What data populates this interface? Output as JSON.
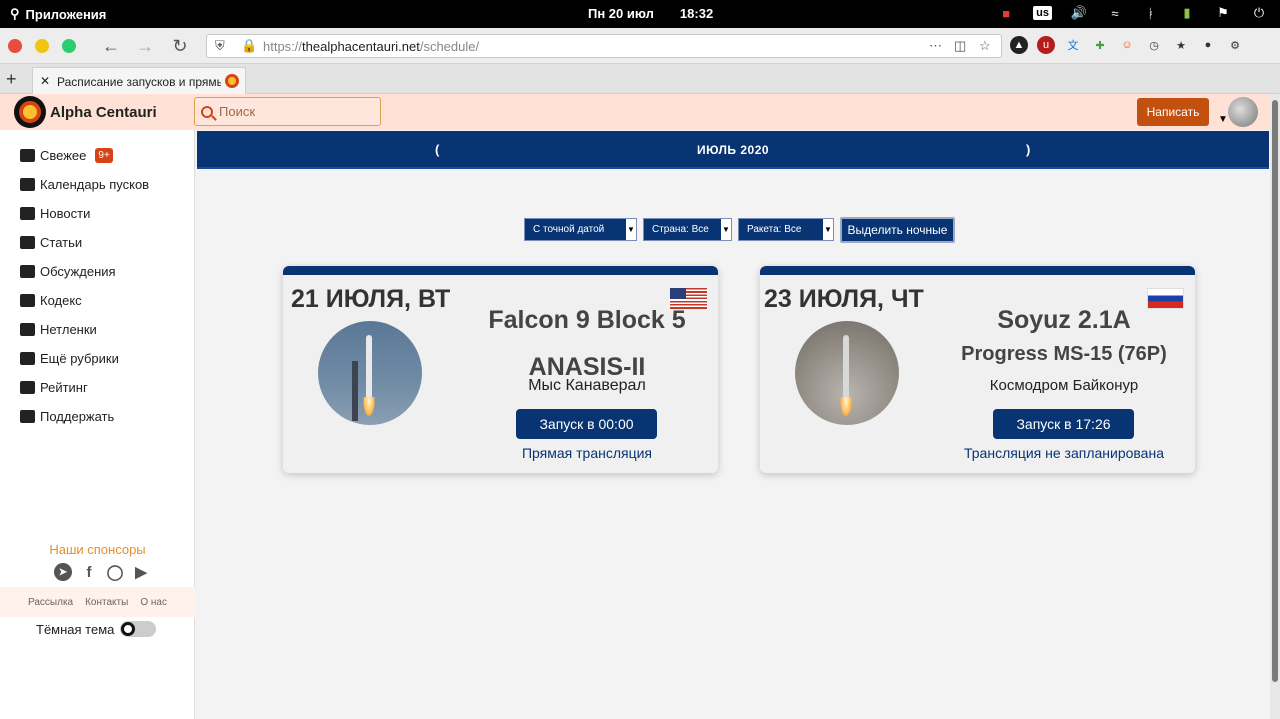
{
  "os": {
    "apps_label": "Приложения",
    "date": "Пн 20 июл",
    "time": "18:32",
    "keyboard_layout": "us"
  },
  "browser": {
    "url_prefix": "https://",
    "url_host": "thealphacentauri.net",
    "url_path": "/schedule/",
    "tab_title": "Расписание запусков и прямых",
    "colors": {
      "brand": "#083474",
      "accent": "#c2500e",
      "header_bg": "#ffe1d6"
    }
  },
  "site": {
    "brand": "Alpha Centauri",
    "search_placeholder": "Поиск",
    "write_label": "Написать"
  },
  "sidebar": {
    "items": [
      {
        "label": "Свежее",
        "icon": "fresh-icon",
        "badge": "9+"
      },
      {
        "label": "Календарь пусков",
        "icon": "calendar-icon"
      },
      {
        "label": "Новости",
        "icon": "news-icon"
      },
      {
        "label": "Статьи",
        "icon": "articles-icon"
      },
      {
        "label": "Обсуждения",
        "icon": "discussions-icon"
      },
      {
        "label": "Кодекс",
        "icon": "gavel-icon"
      },
      {
        "label": "Нетленки",
        "icon": "archive-icon"
      },
      {
        "label": "Ещё рубрики",
        "icon": "list-icon"
      },
      {
        "label": "Рейтинг",
        "icon": "rating-icon"
      },
      {
        "label": "Поддержать",
        "icon": "card-icon"
      }
    ],
    "sponsors_label": "Наши спонсоры",
    "footer_links": [
      "Рассылка",
      "Контакты",
      "О нас"
    ],
    "dark_theme_label": "Тёмная тема"
  },
  "schedule": {
    "prev_label": "(",
    "month": "ИЮЛЬ 2020",
    "next_label": ")",
    "filters": {
      "date_mode": "С точной датой",
      "country": "Страна: Все",
      "rocket": "Ракета: Все",
      "night_label": "Выделить ночные"
    },
    "launches": [
      {
        "date": "21 ИЮЛЯ, ВТ",
        "flag": "usa-flag",
        "rocket": "Falcon 9 Block 5",
        "mission": "ANASIS-II",
        "site": "Мыс Канаверал",
        "launch_label": "Запуск в 00:00",
        "stream_label": "Прямая трансляция"
      },
      {
        "date": "23 ИЮЛЯ, ЧТ",
        "flag": "russia-flag",
        "rocket": "Soyuz 2.1A",
        "mission": "Progress MS-15 (76P)",
        "site": "Космодром Байконур",
        "launch_label": "Запуск в 17:26",
        "stream_label": "Трансляция не запланирована"
      }
    ]
  }
}
